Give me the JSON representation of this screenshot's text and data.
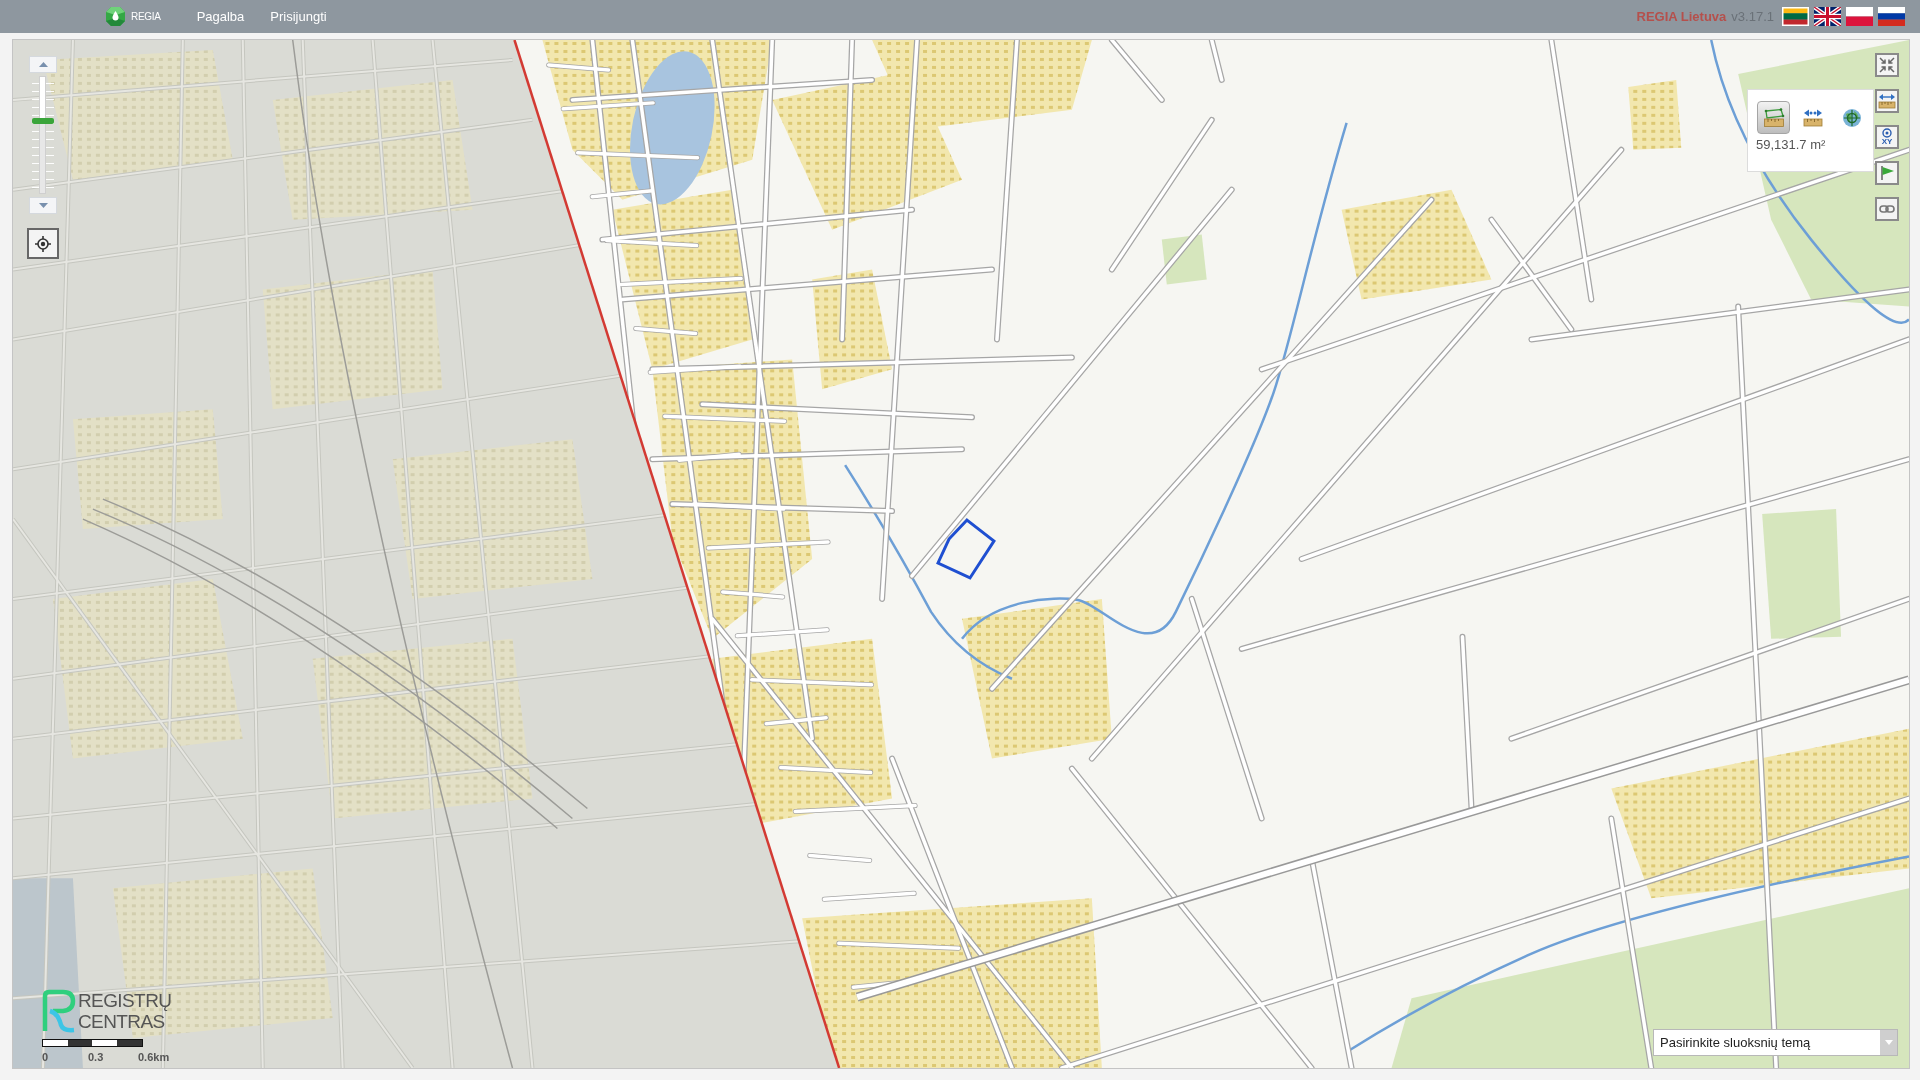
{
  "top_bar": {
    "logo": "REGIA",
    "nav": [
      "Pagalba",
      "Prisijungti"
    ],
    "app_name": "REGIA Lietuva",
    "version": "v3.17.1",
    "languages": [
      {
        "kind": "lt",
        "selected": true
      },
      {
        "kind": "gb",
        "selected": false
      },
      {
        "kind": "pl",
        "selected": false
      },
      {
        "kind": "ru",
        "selected": false
      }
    ]
  },
  "map": {
    "zoom": {
      "level": 0.62
    },
    "toolbar": [
      {
        "kind": "collapse"
      },
      {
        "kind": "measure"
      },
      {
        "kind": "coordinates",
        "text": "XY"
      },
      {
        "kind": "flag"
      },
      {
        "kind": "link"
      }
    ],
    "measure_panel": {
      "tools": [
        {
          "kind": "area",
          "selected": true
        },
        {
          "kind": "distance",
          "selected": false
        },
        {
          "kind": "point",
          "selected": false
        }
      ],
      "result": "59,131.7 m²"
    },
    "logo": {
      "lines": [
        "REGISTRŲ",
        "CENTRAS"
      ]
    },
    "scale": {
      "labels": [
        "0",
        "0.3",
        "0.6km"
      ]
    },
    "layer_theme": {
      "value": "Pasirinkite sluoksnių temą"
    }
  }
}
